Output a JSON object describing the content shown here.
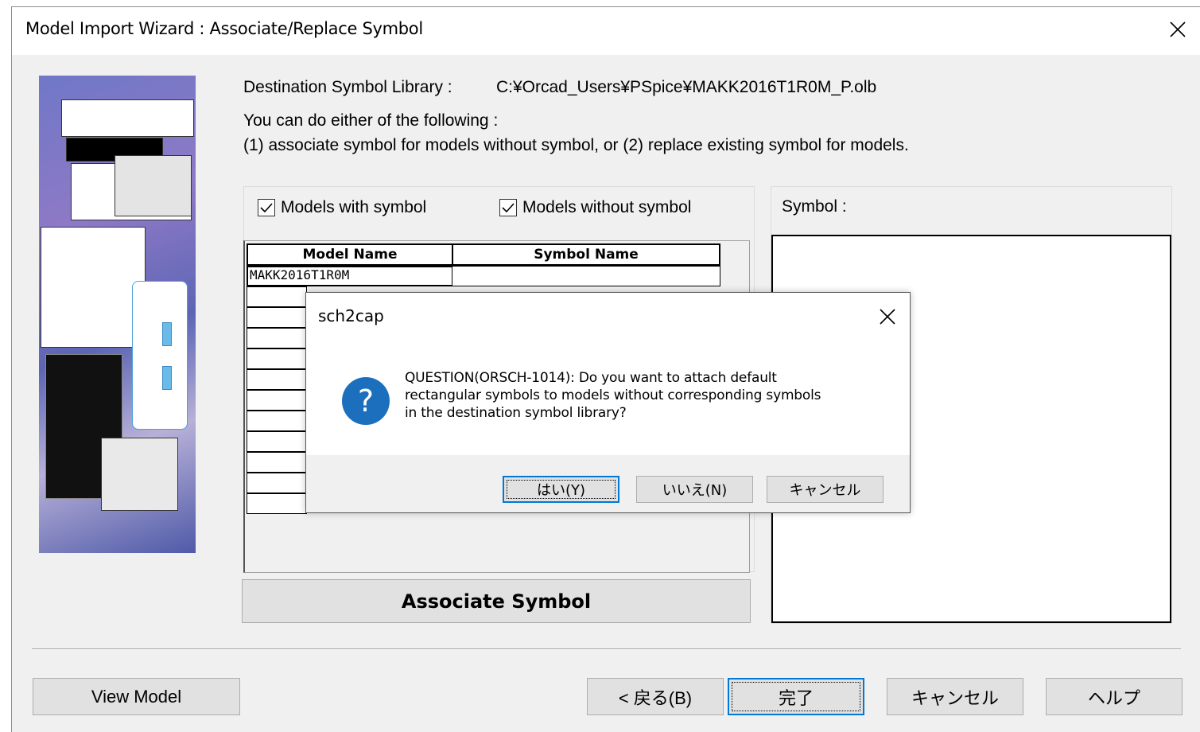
{
  "window": {
    "title": "Model Import Wizard : Associate/Replace Symbol"
  },
  "content": {
    "dest_label": "Destination Symbol Library :",
    "dest_value": "C:¥Orcad_Users¥PSpice¥MAKK2016T1R0M_P.olb",
    "intro_line1": "You can do either of the following :",
    "intro_line2": "(1) associate symbol for models without symbol, or (2) replace existing symbol for models."
  },
  "filters": {
    "with_symbol": {
      "label": "Models with symbol",
      "checked": true
    },
    "without_symbol": {
      "label": "Models without symbol",
      "checked": true
    }
  },
  "table": {
    "columns": [
      "Model Name",
      "Symbol Name"
    ],
    "rows": [
      {
        "model": "MAKK2016T1R0M",
        "symbol": ""
      }
    ]
  },
  "associate_button": "Associate Symbol",
  "symbol_panel": {
    "label": "Symbol :"
  },
  "footer": {
    "view_model": "View Model",
    "back": "< 戻る(B)",
    "finish": "完了",
    "cancel": "キャンセル",
    "help": "ヘルプ"
  },
  "dialog": {
    "title": "sch2cap",
    "message_line1": "QUESTION(ORSCH-1014): Do you want to attach default",
    "message_line2": "rectangular symbols to models without corresponding symbols",
    "message_line3": "in the destination symbol library?",
    "yes": "はい(Y)",
    "no": "いいえ(N)",
    "cancel": "キャンセル",
    "icon": "question-icon",
    "accent": "#1b6fbd"
  }
}
